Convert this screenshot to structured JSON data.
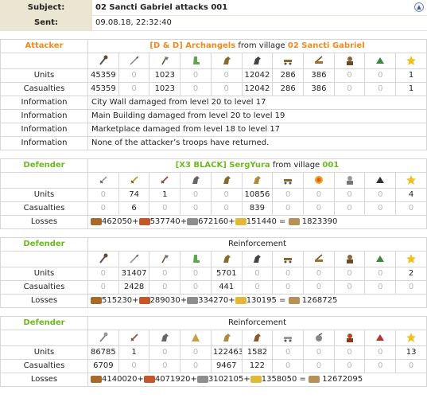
{
  "header": {
    "subject_label": "Subject:",
    "subject_value": "02 Sancti Gabriel attacks 001",
    "sent_label": "Sent:",
    "sent_value": "09.08.18, 22:32:40"
  },
  "attacker": {
    "role": "Attacker",
    "player": "[D & D] Archangels",
    "from_text": "from village",
    "village": "02 Sancti Gabriel",
    "icons": [
      "club-icon",
      "spear-icon",
      "axe-icon",
      "boot-icon",
      "horse-icon",
      "horse-icon",
      "ram-icon",
      "catapult-icon",
      "chief-icon",
      "settler-icon",
      "hero-icon"
    ],
    "units_label": "Units",
    "units": [
      "45359",
      "0",
      "1023",
      "0",
      "0",
      "12042",
      "286",
      "386",
      "0",
      "0",
      "1"
    ],
    "casualties_label": "Casualties",
    "casualties": [
      "45359",
      "0",
      "1023",
      "0",
      "0",
      "12042",
      "286",
      "386",
      "0",
      "0",
      "1"
    ],
    "info_label": "Information",
    "info": [
      "City Wall damaged from level 20 to level 17",
      "Main Building damaged from level 20 to level 19",
      "Marketplace damaged from level 18 to level 17",
      "None of the attacker’s troops have returned."
    ]
  },
  "defender": {
    "role": "Defender",
    "player": "[X3 BLACK] SergYura",
    "from_text": "from village",
    "village": "001",
    "icons": [
      "sword-icon",
      "sword-icon",
      "sword-icon",
      "horse-icon",
      "horse-icon",
      "horse-icon",
      "ram-icon",
      "catapult-icon",
      "chief-icon",
      "settler-icon",
      "hero-icon"
    ],
    "units_label": "Units",
    "units": [
      "0",
      "74",
      "1",
      "0",
      "0",
      "10856",
      "0",
      "0",
      "0",
      "0",
      "4"
    ],
    "casualties_label": "Casualties",
    "casualties": [
      "0",
      "6",
      "0",
      "0",
      "0",
      "839",
      "0",
      "0",
      "0",
      "0",
      "0"
    ],
    "losses_label": "Losses",
    "losses": [
      "462050+",
      "537740+",
      "672160+",
      "151440 =",
      "1823390"
    ]
  },
  "reinforcement1": {
    "role": "Defender",
    "title": "Reinforcement",
    "icons": [
      "club-icon",
      "spear-icon",
      "axe-icon",
      "boot-icon",
      "horse-icon",
      "horse-icon",
      "ram-icon",
      "catapult-icon",
      "chief-icon",
      "settler-icon",
      "hero-icon"
    ],
    "units_label": "Units",
    "units": [
      "0",
      "31407",
      "0",
      "0",
      "5701",
      "0",
      "0",
      "0",
      "0",
      "0",
      "2"
    ],
    "casualties_label": "Casualties",
    "casualties": [
      "0",
      "2428",
      "0",
      "0",
      "441",
      "0",
      "0",
      "0",
      "0",
      "0",
      "0"
    ],
    "losses_label": "Losses",
    "losses": [
      "515230+",
      "289030+",
      "334270+",
      "130195 =",
      "1268725"
    ]
  },
  "reinforcement2": {
    "role": "Defender",
    "title": "Reinforcement",
    "icons": [
      "mace-icon",
      "sword-icon",
      "horse-icon",
      "scout-icon",
      "horse-icon",
      "horse-icon",
      "ram-icon",
      "catapult-icon",
      "chief-icon",
      "settler-icon",
      "hero-icon"
    ],
    "units_label": "Units",
    "units": [
      "86785",
      "1",
      "0",
      "0",
      "122463",
      "1582",
      "0",
      "0",
      "0",
      "0",
      "13"
    ],
    "casualties_label": "Casualties",
    "casualties": [
      "6709",
      "0",
      "0",
      "0",
      "9467",
      "122",
      "0",
      "0",
      "0",
      "0",
      "0"
    ],
    "losses_label": "Losses",
    "losses": [
      "4140020+",
      "4071920+",
      "3102105+",
      "1358050 =",
      "12672095"
    ]
  }
}
